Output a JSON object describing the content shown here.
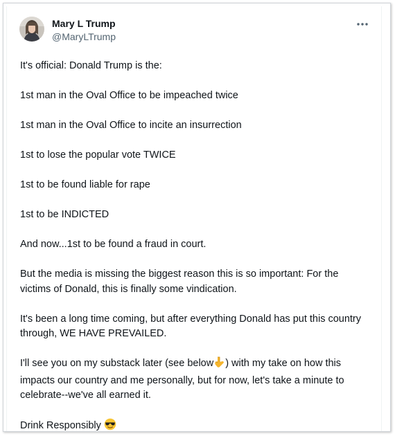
{
  "tweet": {
    "author": {
      "display_name": "Mary L Trump",
      "handle": "@MaryLTrump"
    },
    "more_icon": "ellipsis-icon",
    "paragraphs": [
      "It's official: Donald Trump is the:",
      "1st man in the Oval Office to be impeached twice",
      "1st man in the Oval Office to incite an insurrection",
      "1st to lose the popular vote TWICE",
      "1st to be found liable for rape",
      "1st to be INDICTED",
      "And now...1st to be found a fraud in court.",
      "But the media is missing the biggest reason this is so important: For the victims of Donald, this is finally some vindication.",
      "It's been a long time coming, but after everything Donald has put this country through, WE HAVE PREVAILED."
    ],
    "substack_part1": "I'll see you on my substack later (see below",
    "substack_part2": ") with my take on how this impacts our country and me personally, but for now, let's take a minute to celebrate--we've all earned it.",
    "closing": "Drink Responsibly",
    "pointing_emoji_icon": "backhand-index-pointing-down-icon",
    "sunglasses_emoji_icon": "smiling-face-with-sunglasses-icon"
  }
}
